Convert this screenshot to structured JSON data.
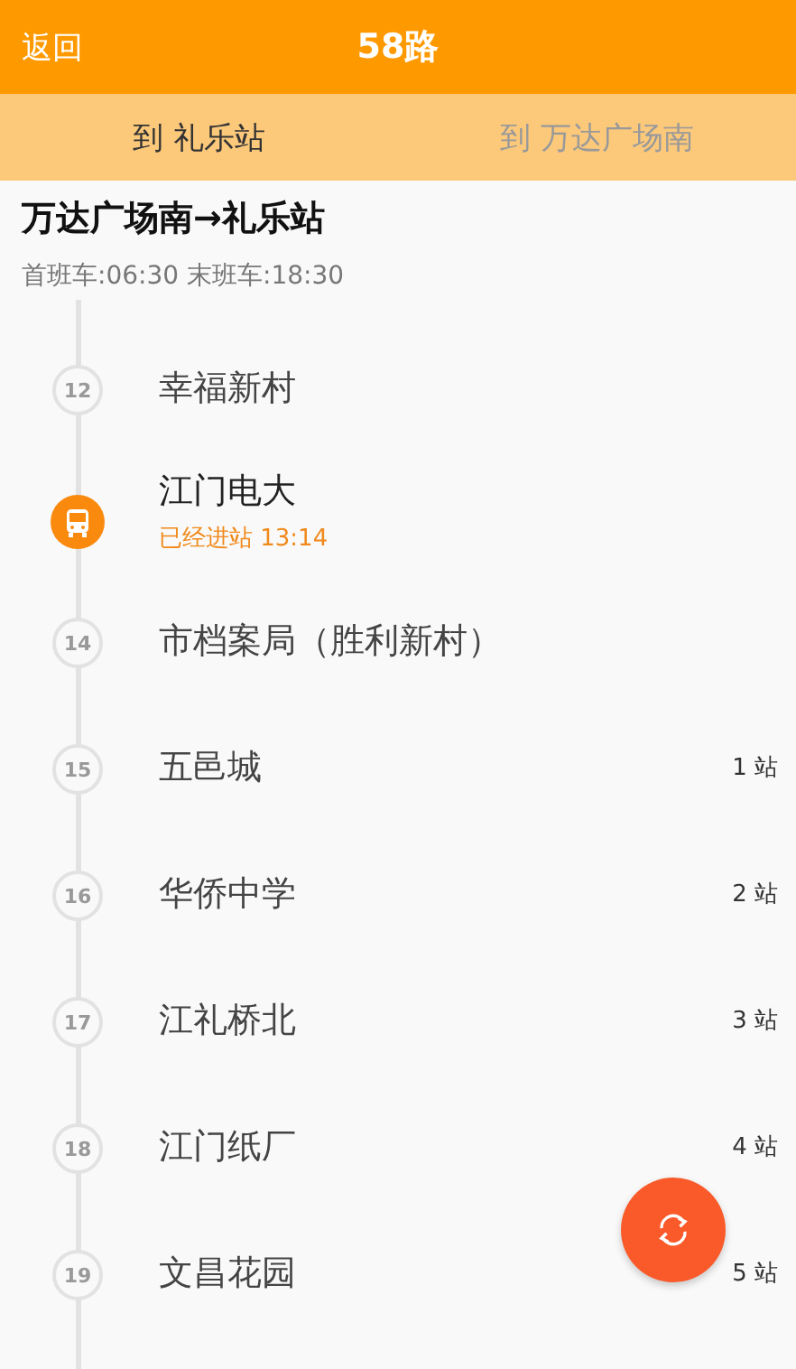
{
  "header": {
    "back": "返回",
    "title": "58路"
  },
  "tabs": [
    {
      "label": "到 礼乐站",
      "selected": true
    },
    {
      "label": "到 万达广场南",
      "selected": false
    }
  ],
  "route": {
    "title": "万达广场南→礼乐站",
    "schedule": "首班车:06:30 末班车:18:30"
  },
  "stops": [
    {
      "number": "12",
      "name": "幸福新村",
      "bus_here": false
    },
    {
      "name": "江门电大",
      "bus_here": true,
      "status": "已经进站 13:14"
    },
    {
      "number": "14",
      "name": "市档案局（胜利新村）",
      "bus_here": false
    },
    {
      "number": "15",
      "name": "五邑城",
      "bus_here": false,
      "distance": "1 站"
    },
    {
      "number": "16",
      "name": "华侨中学",
      "bus_here": false,
      "distance": "2 站"
    },
    {
      "number": "17",
      "name": "江礼桥北",
      "bus_here": false,
      "distance": "3 站"
    },
    {
      "number": "18",
      "name": "江门纸厂",
      "bus_here": false,
      "distance": "4 站"
    },
    {
      "number": "19",
      "name": "文昌花园",
      "bus_here": false,
      "distance": "5 站"
    }
  ]
}
